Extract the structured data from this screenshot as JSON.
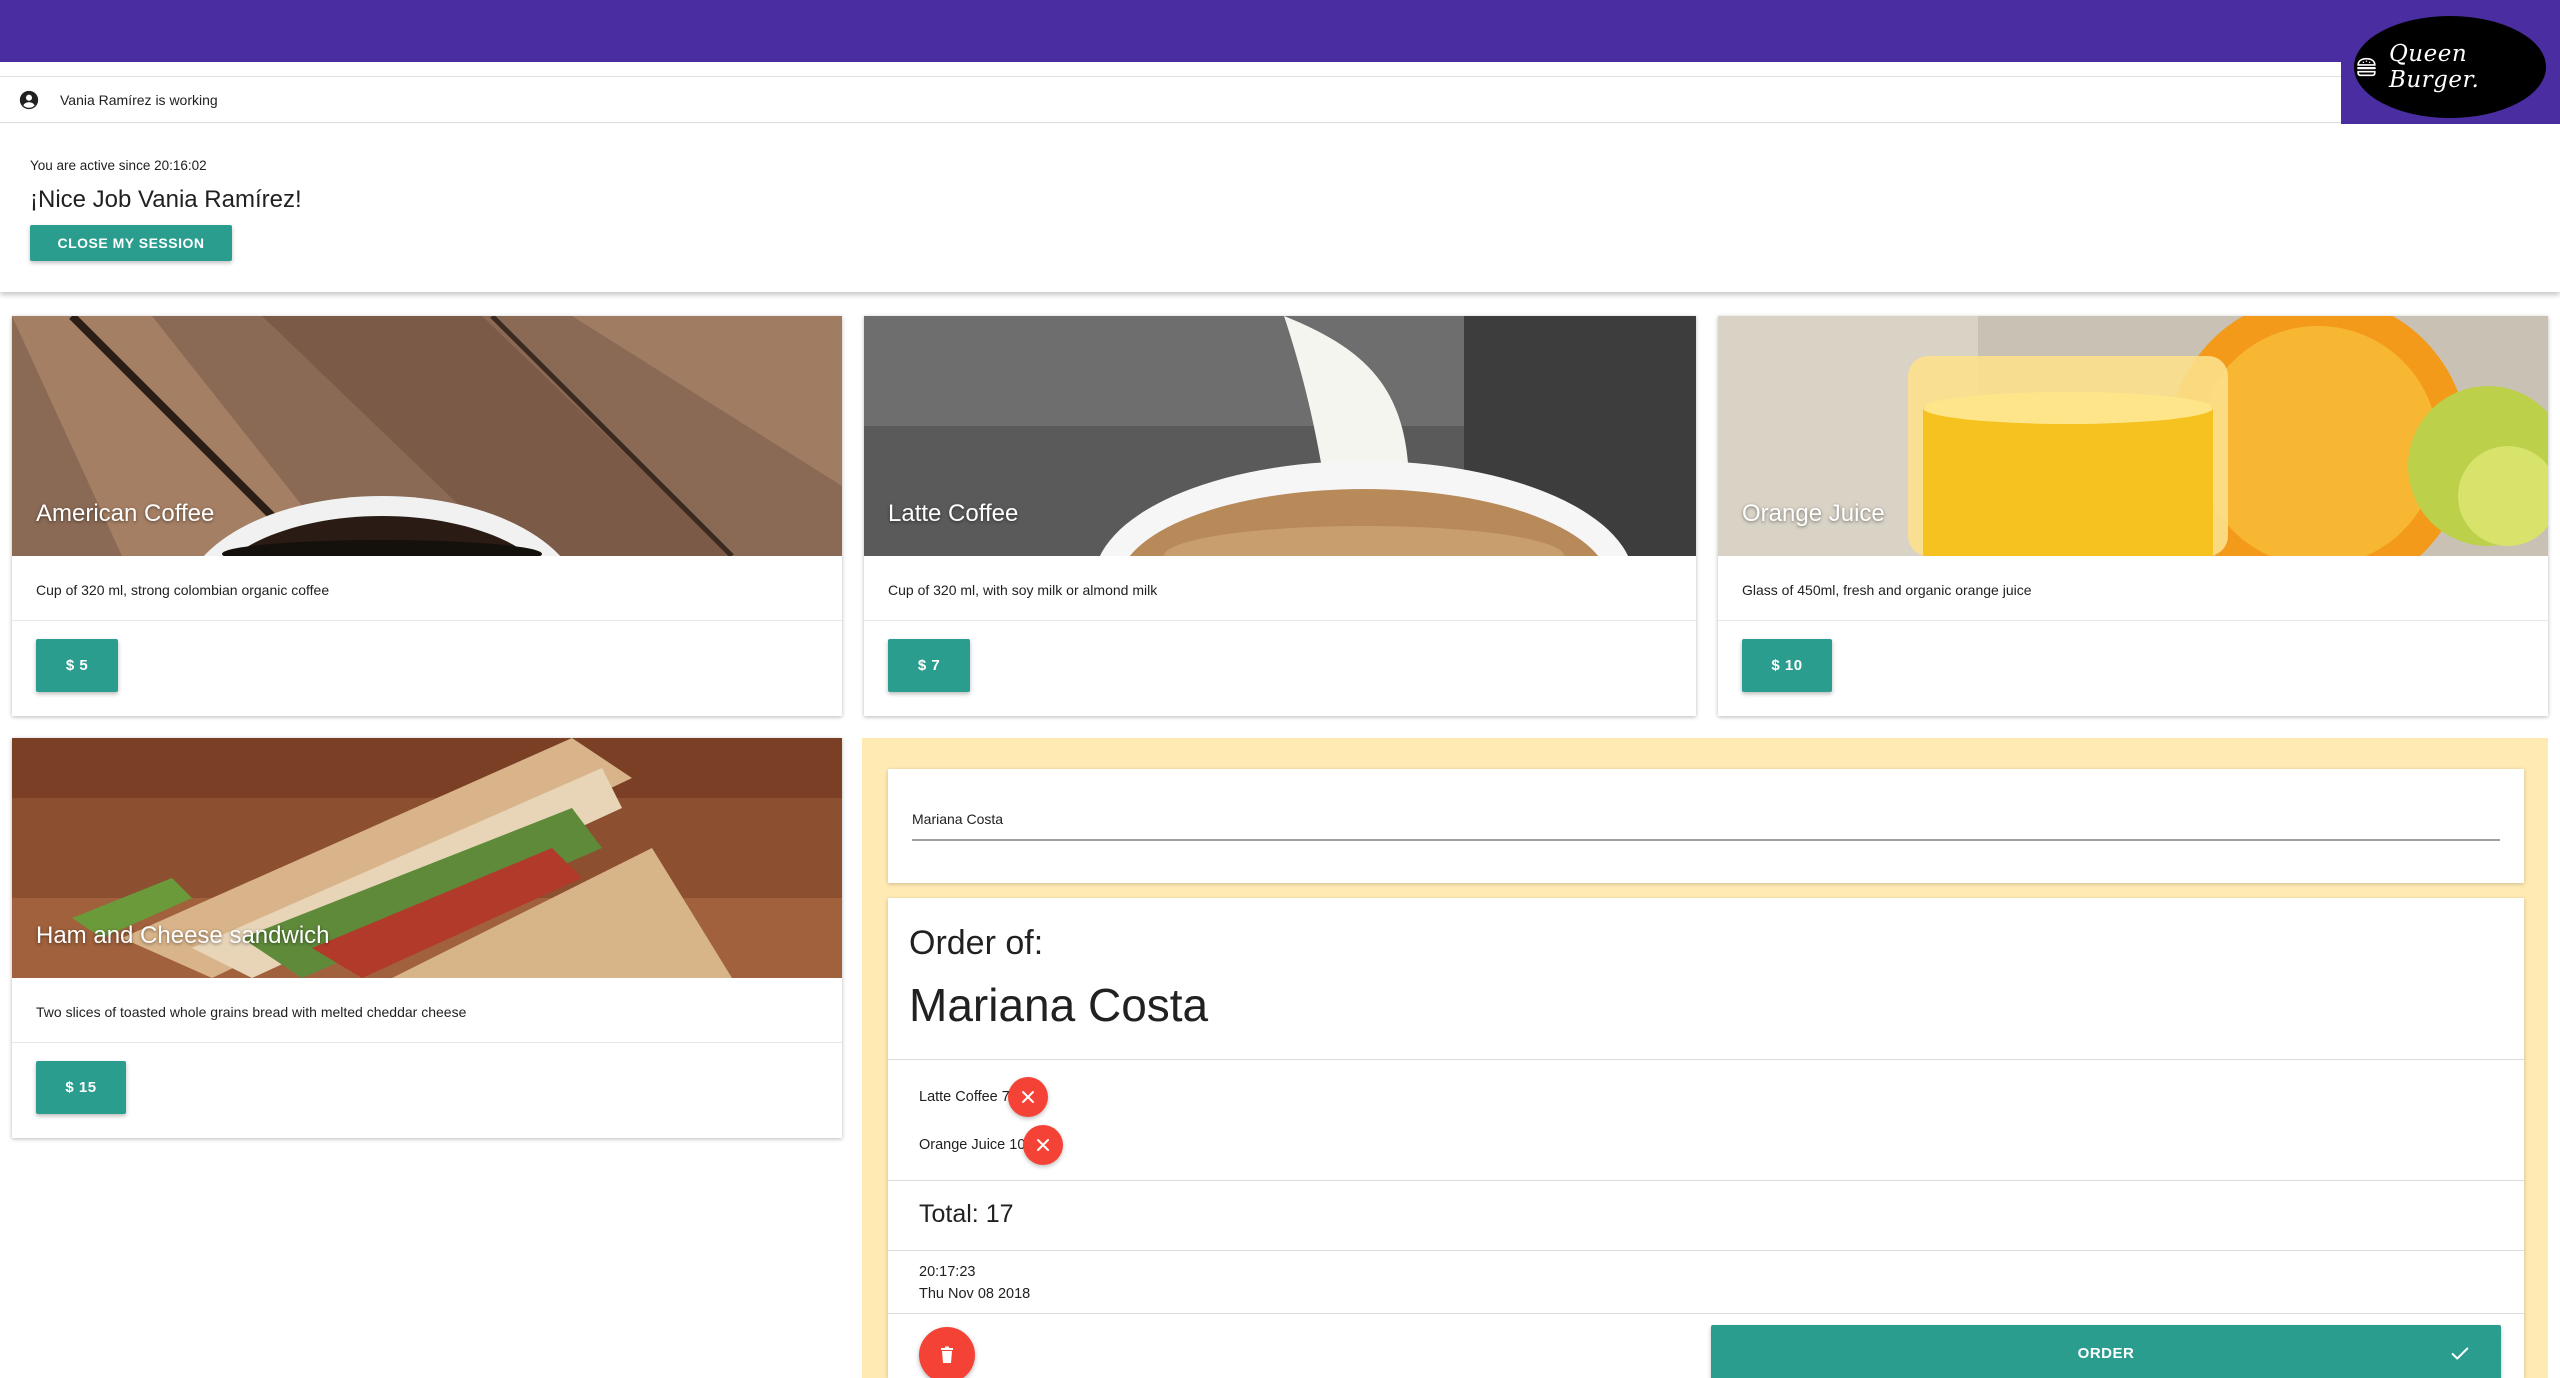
{
  "header": {
    "logo_text": "Queen Burger.",
    "status_text": "Vania Ramírez is working"
  },
  "session": {
    "active_since": "You are active since 20:16:02",
    "greeting": "¡Nice Job Vania Ramírez!",
    "close_button": "CLOSE MY SESSION"
  },
  "products": [
    {
      "title": "American Coffee",
      "description": "Cup of 320 ml, strong colombian organic coffee",
      "price": "$ 5"
    },
    {
      "title": "Latte Coffee",
      "description": "Cup of 320 ml, with soy milk or almond milk",
      "price": "$ 7"
    },
    {
      "title": "Orange Juice",
      "description": "Glass of 450ml, fresh and organic orange juice",
      "price": "$ 10"
    },
    {
      "title": "Ham and Cheese sandwich",
      "description": "Two slices of toasted whole grains bread with melted cheddar cheese",
      "price": "$ 15"
    }
  ],
  "order": {
    "customer_input_value": "Mariana Costa",
    "heading": "Order of:",
    "customer_name": "Mariana Costa",
    "items": [
      {
        "label": "Latte Coffee 7"
      },
      {
        "label": "Orange Juice 10"
      }
    ],
    "total": "Total: 17",
    "time": "20:17:23",
    "date": "Thu Nov 08 2018",
    "order_button": "ORDER"
  },
  "colors": {
    "header": "#4a2da0",
    "accent": "#2a9d8f",
    "danger": "#f44336",
    "order_panel": "#ffeab3"
  }
}
